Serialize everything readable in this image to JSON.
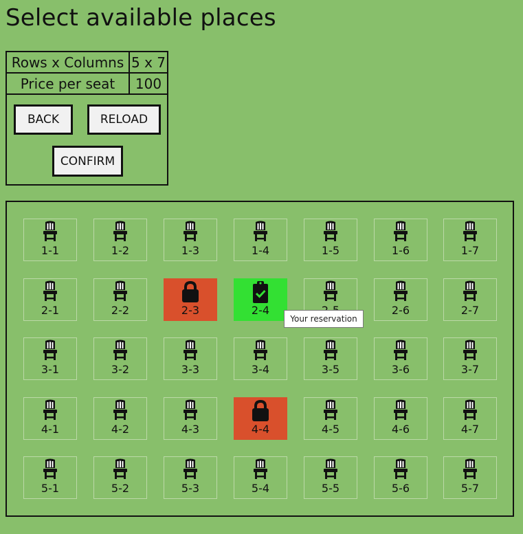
{
  "title": "Select available places",
  "info": {
    "rows_label": "Rows x Columns",
    "rows_value": "5 x 7",
    "price_label": "Price per seat",
    "price_value": "100"
  },
  "buttons": {
    "back": "BACK",
    "reload": "RELOAD",
    "confirm": "CONFIRM"
  },
  "tooltip": "Your reservation",
  "seats": {
    "rows": 5,
    "cols": 7,
    "locked": [
      "2-3",
      "4-4"
    ],
    "mine": [
      "2-4"
    ],
    "icons": {
      "free": "chair-icon",
      "locked": "lock-icon",
      "mine": "clipboard-check-icon"
    }
  },
  "colors": {
    "background": "#88bf6b",
    "locked": "#d9502c",
    "mine": "#33e033"
  }
}
